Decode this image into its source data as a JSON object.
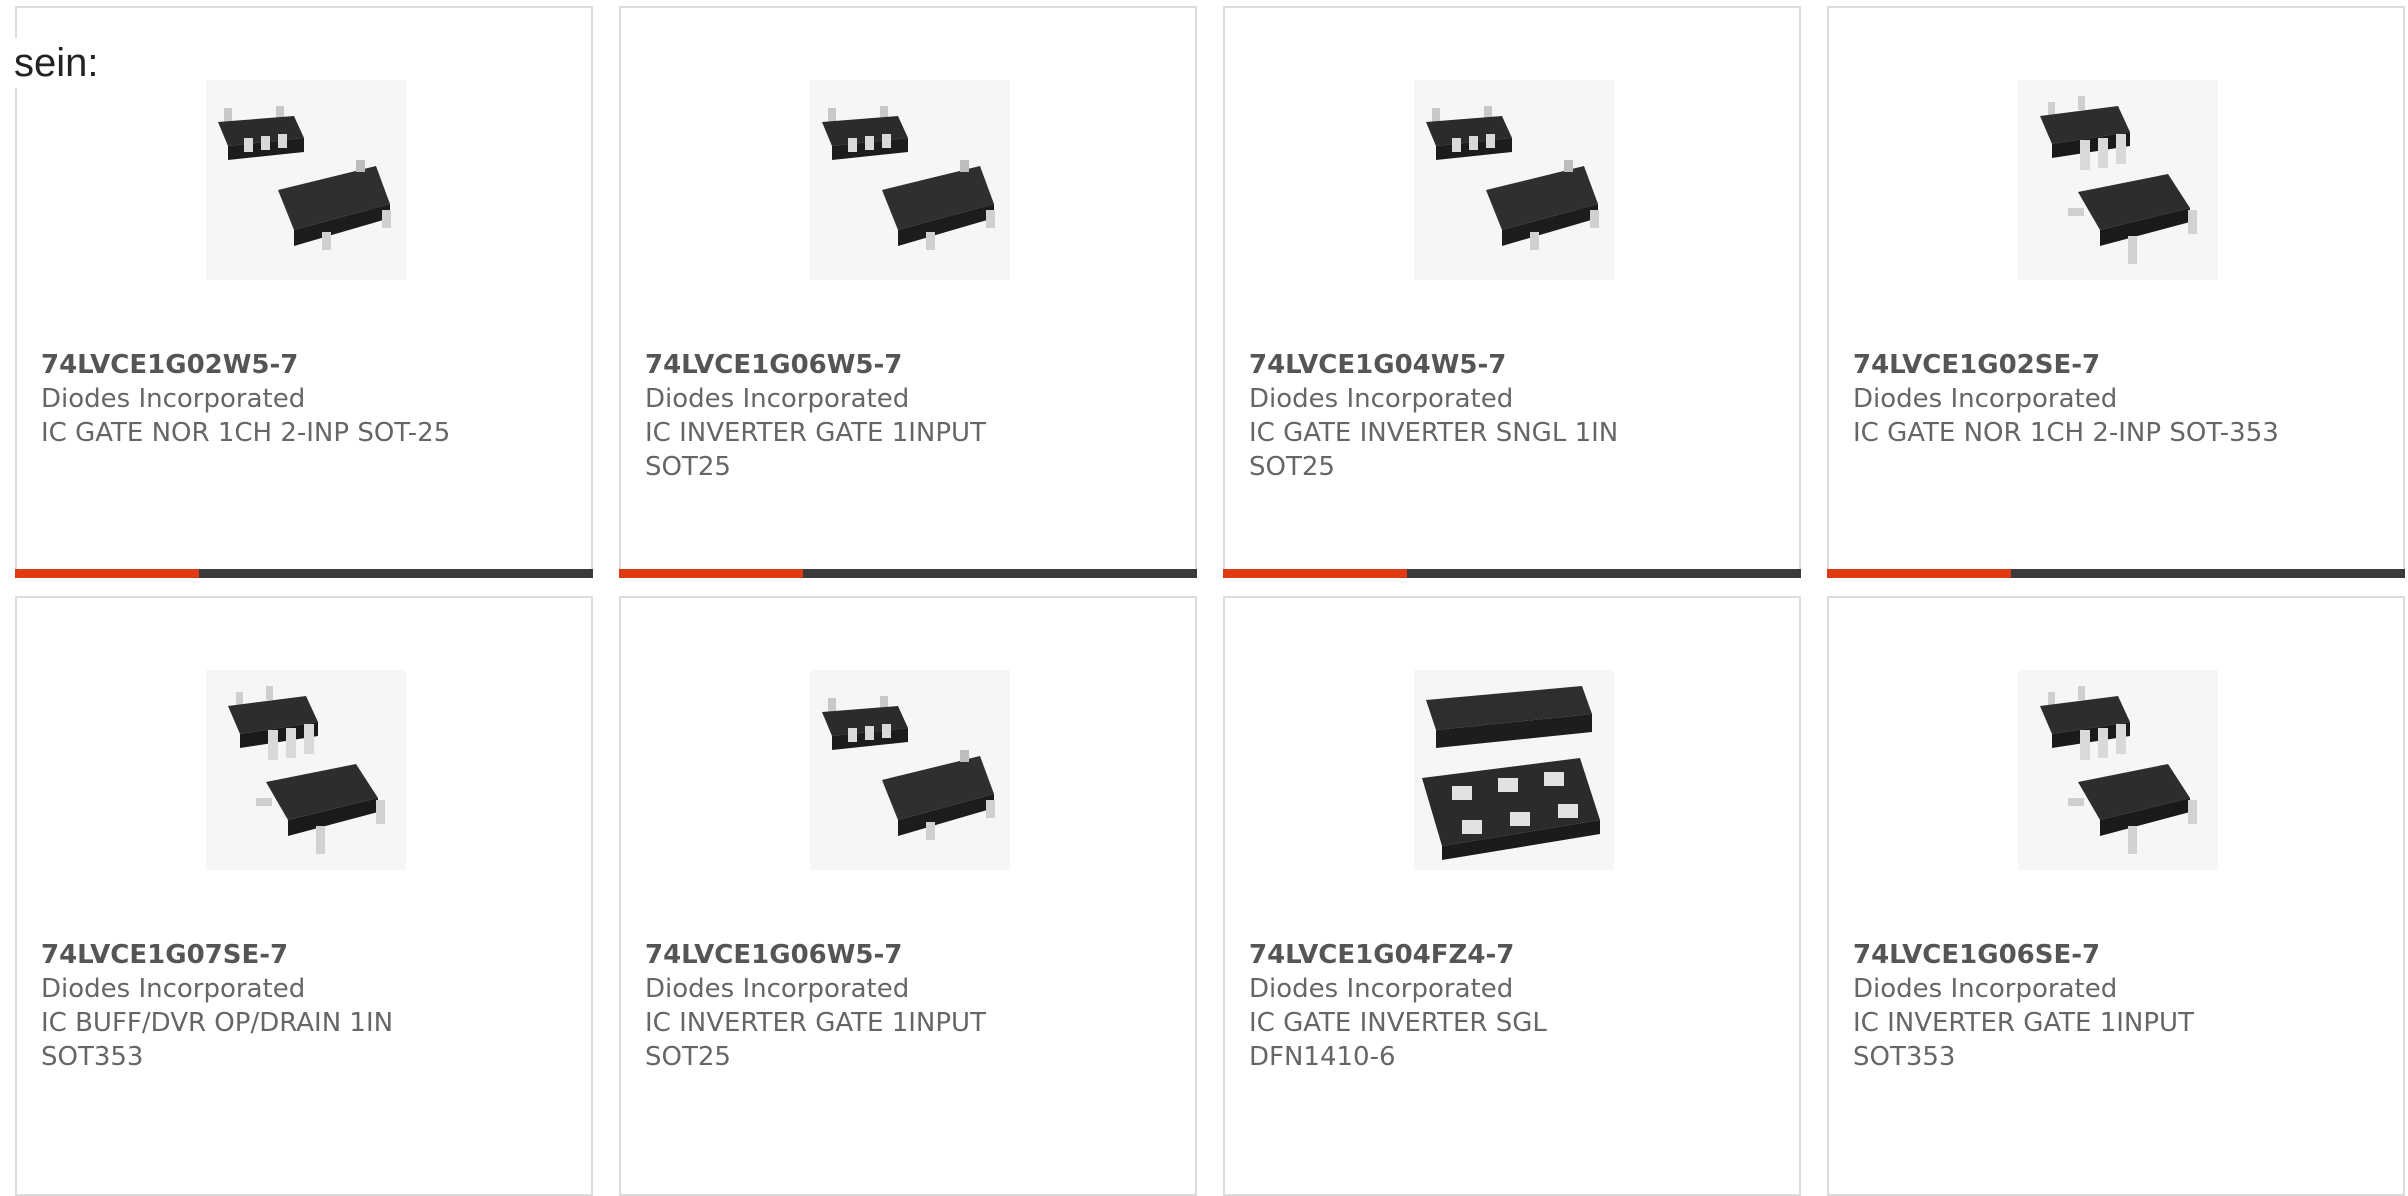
{
  "intro": "sein:",
  "colors": {
    "accent": "#e03a12",
    "bar": "#3b3b3b",
    "border": "#dcdcdc"
  },
  "products": [
    {
      "part": "74LVCE1G02W5-7",
      "mfr": "Diodes Incorporated",
      "desc1": "IC GATE NOR 1CH 2-INP SOT-25",
      "desc2": "",
      "icon": "sot25-package-image"
    },
    {
      "part": "74LVCE1G06W5-7",
      "mfr": "Diodes Incorporated",
      "desc1": "IC INVERTER GATE 1INPUT",
      "desc2": "SOT25",
      "icon": "sot25-package-image"
    },
    {
      "part": "74LVCE1G04W5-7",
      "mfr": "Diodes Incorporated",
      "desc1": "IC GATE INVERTER SNGL 1IN",
      "desc2": "SOT25",
      "icon": "sot25-package-image"
    },
    {
      "part": "74LVCE1G02SE-7",
      "mfr": "Diodes Incorporated",
      "desc1": "IC GATE NOR 1CH 2-INP SOT-353",
      "desc2": "",
      "icon": "sot353-package-image"
    },
    {
      "part": "74LVCE1G07SE-7",
      "mfr": "Diodes Incorporated",
      "desc1": "IC BUFF/DVR OP/DRAIN 1IN",
      "desc2": "SOT353",
      "icon": "sot353-package-image"
    },
    {
      "part": "74LVCE1G06W5-7",
      "mfr": "Diodes Incorporated",
      "desc1": "IC INVERTER GATE 1INPUT",
      "desc2": "SOT25",
      "icon": "sot25-package-image"
    },
    {
      "part": "74LVCE1G04FZ4-7",
      "mfr": "Diodes Incorporated",
      "desc1": "IC GATE INVERTER SGL",
      "desc2": "DFN1410-6",
      "icon": "dfn-package-image"
    },
    {
      "part": "74LVCE1G06SE-7",
      "mfr": "Diodes Incorporated",
      "desc1": "IC INVERTER GATE 1INPUT",
      "desc2": "SOT353",
      "icon": "sot353-package-image"
    }
  ]
}
